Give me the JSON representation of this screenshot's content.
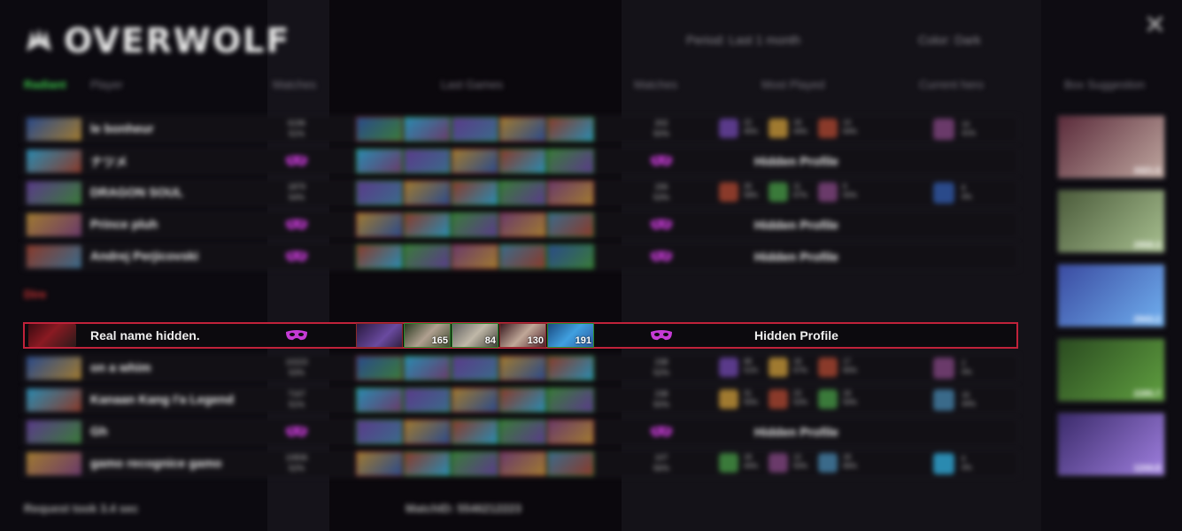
{
  "app": {
    "logo_text": "OVERWOLF"
  },
  "header": {
    "period_label": "Period: Last 1 month",
    "color_label": "Color: Dark",
    "close_label": "✕"
  },
  "columns": {
    "radiant": "Radiant",
    "player": "Player",
    "matches": "Matches",
    "last_games": "Last Games",
    "matches2": "Matches",
    "most_played": "Most Played",
    "current_hero": "Current hero",
    "box_suggestion": "Box Suggestion"
  },
  "team_dire": "Dire",
  "radiant_players": [
    {
      "name": "le bonheur",
      "matches": "6196",
      "winrate": "51%",
      "hidden": false,
      "m2": "202",
      "m2r": "50%",
      "mp": [
        [
          "22",
          "45%"
        ],
        [
          "18",
          "44%"
        ],
        [
          "14",
          "64%"
        ]
      ],
      "cur": [
        "14",
        "41%"
      ]
    },
    {
      "name": "ナツメ",
      "matches": "",
      "winrate": "",
      "hidden": true
    },
    {
      "name": "DRAGON SOUL",
      "matches": "1879",
      "winrate": "54%",
      "hidden": false,
      "m2": "156",
      "m2r": "53%",
      "mp": [
        [
          "26",
          "58%"
        ],
        [
          "11",
          "67%"
        ],
        [
          "9",
          "55%"
        ]
      ],
      "cur": [
        "8",
        "0%"
      ]
    },
    {
      "name": "Prince pluh",
      "matches": "",
      "winrate": "",
      "hidden": true
    },
    {
      "name": "Andrej Perjicovski",
      "matches": "",
      "winrate": "",
      "hidden": true
    }
  ],
  "focus_player": {
    "name": "Real name hidden.",
    "hidden_label": "Hidden Profile",
    "games": [
      {
        "num": ""
      },
      {
        "num": "165"
      },
      {
        "num": "84"
      },
      {
        "num": "130"
      },
      {
        "num": "191"
      }
    ]
  },
  "dire_players": [
    {
      "name": "on a whim",
      "matches": "10223",
      "winrate": "53%",
      "hidden": false,
      "m2": "238",
      "m2r": "52%",
      "mp": [
        [
          "68",
          "51%"
        ],
        [
          "18",
          "67%"
        ],
        [
          "17",
          "65%"
        ]
      ],
      "cur": [
        "2",
        "0%"
      ]
    },
    {
      "name": "Kanaan Kang I'a Legend",
      "matches": "7167",
      "winrate": "51%",
      "hidden": false,
      "m2": "238",
      "m2r": "50%",
      "mp": [
        [
          "31",
          "55%"
        ],
        [
          "23",
          "52%"
        ],
        [
          "18",
          "50%"
        ]
      ],
      "cur": [
        "16",
        "44%"
      ]
    },
    {
      "name": "Gh",
      "matches": "",
      "winrate": "",
      "hidden": true
    },
    {
      "name": "gamo recognice gamo",
      "matches": "10836",
      "winrate": "52%",
      "hidden": false,
      "m2": "107",
      "m2r": "56%",
      "mp": [
        [
          "18",
          "44%"
        ],
        [
          "12",
          "50%"
        ],
        [
          "18",
          "66%"
        ]
      ],
      "cur": [
        "6",
        "0%"
      ]
    }
  ],
  "hidden_profile_label": "Hidden Profile",
  "suggestions": [
    "3321.5",
    "2958.3",
    "2943.2",
    "2285.7",
    "1244.8"
  ],
  "footer": {
    "request": "Request took 3.4 sec",
    "matchid": "MatchID: 5546212223"
  },
  "colors": {
    "accent_red": "#c0223a",
    "mask_purple": "#c63bd6",
    "win_green": "#2a8a2a",
    "radiant_green": "#3bc94a"
  }
}
